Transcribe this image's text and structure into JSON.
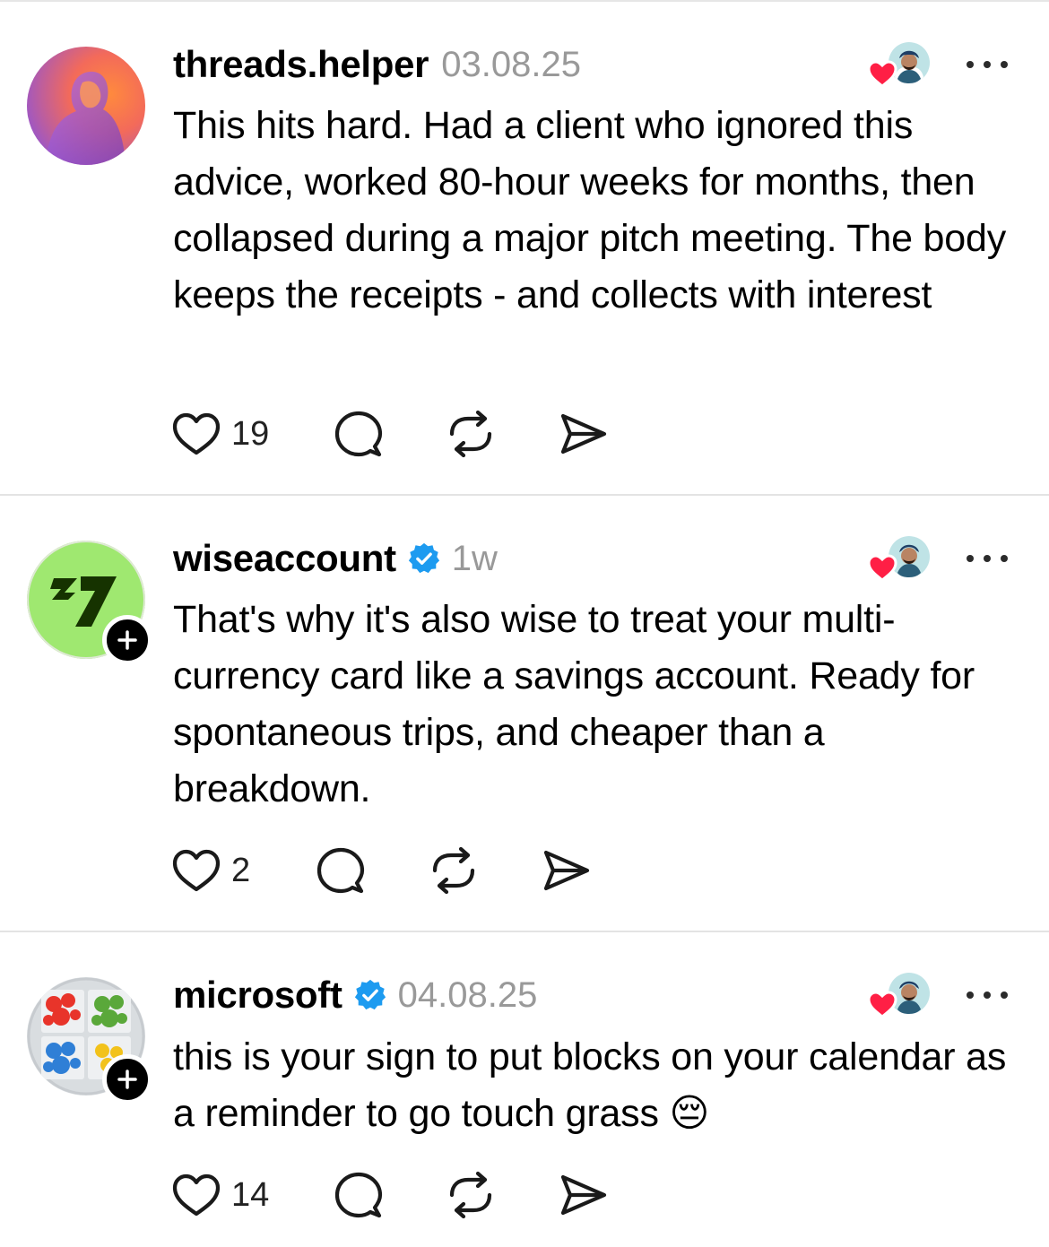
{
  "posts": [
    {
      "username": "threads.helper",
      "verified": false,
      "timestamp": "03.08.25",
      "follow_plus": false,
      "text": "This hits hard. Had a client who ignored this advice, worked 80-hour weeks for months, then collapsed during a major pitch meeting. The body keeps the receipts - and collects with interest",
      "likes": "19",
      "avatar_icon": "avatar-photo-purple-orange"
    },
    {
      "username": "wiseaccount",
      "verified": true,
      "timestamp": "1w",
      "follow_plus": true,
      "text": "That's why it's also wise to treat your multi-currency card like a savings account. Ready for spontaneous trips, and cheaper than a breakdown.",
      "likes": "2",
      "avatar_icon": "wise-logo"
    },
    {
      "username": "microsoft",
      "verified": true,
      "timestamp": "04.08.25",
      "follow_plus": true,
      "text": "this is your sign to put blocks on your calendar as a reminder to go touch grass 😔",
      "likes": "14",
      "avatar_icon": "microsoft-flower-blocks"
    }
  ],
  "colors": {
    "verified": "#1d9bf0",
    "heart_red": "#ff1f45",
    "wise_green": "#9fe870",
    "wise_dark": "#163300",
    "timestamp_gray": "#999999"
  },
  "icons": {
    "like": "heart-outline-icon",
    "reply": "speech-bubble-icon",
    "repost": "repost-icon",
    "share": "send-icon",
    "more": "more-dots-icon",
    "liked_by": "liked-by-avatar-heart"
  }
}
